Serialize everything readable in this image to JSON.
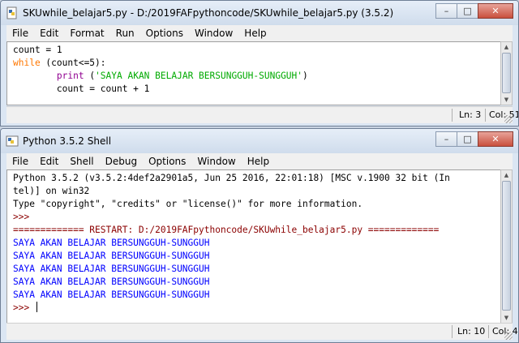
{
  "editor": {
    "title": "SKUwhile_belajar5.py - D:/2019FAFpythoncode/SKUwhile_belajar5.py (3.5.2)",
    "menus": [
      "File",
      "Edit",
      "Format",
      "Run",
      "Options",
      "Window",
      "Help"
    ],
    "code": {
      "line1": "count = 1",
      "line2_kw": "while",
      "line2_rest": " (count<=5):",
      "line3_indent": "        ",
      "line3_fn": "print",
      "line3_open": " (",
      "line3_str": "'SAYA AKAN BELAJAR BERSUNGGUH-SUNGGUH'",
      "line3_close": ")",
      "line4": "        count = count + 1"
    },
    "status": {
      "ln": "Ln: 3",
      "col": "Col: 51"
    }
  },
  "shell": {
    "title": "Python 3.5.2 Shell",
    "menus": [
      "File",
      "Edit",
      "Shell",
      "Debug",
      "Options",
      "Window",
      "Help"
    ],
    "banner1": "Python 3.5.2 (v3.5.2:4def2a2901a5, Jun 25 2016, 22:01:18) [MSC v.1900 32 bit (In",
    "banner2": "tel)] on win32",
    "banner3": "Type \"copyright\", \"credits\" or \"license()\" for more information.",
    "prompt": ">>> ",
    "restart": "============= RESTART: D:/2019FAFpythoncode/SKUwhile_belajar5.py =============",
    "output": [
      "SAYA AKAN BELAJAR BERSUNGGUH-SUNGGUH",
      "SAYA AKAN BELAJAR BERSUNGGUH-SUNGGUH",
      "SAYA AKAN BELAJAR BERSUNGGUH-SUNGGUH",
      "SAYA AKAN BELAJAR BERSUNGGUH-SUNGGUH",
      "SAYA AKAN BELAJAR BERSUNGGUH-SUNGGUH"
    ],
    "status": {
      "ln": "Ln: 10",
      "col": "Col: 4"
    }
  },
  "controls": {
    "minimize": "–",
    "maximize": "□",
    "close": "✕"
  },
  "icons": {
    "editor_window": "python-file-icon",
    "shell_window": "python-shell-icon",
    "minimize": "minimize-icon",
    "maximize": "maximize-icon",
    "close": "close-icon"
  },
  "colors": {
    "keyword": "#ff7700",
    "builtin": "#900090",
    "string": "#00aa00",
    "stdout": "#0000ff",
    "prompt": "#8b0000"
  }
}
